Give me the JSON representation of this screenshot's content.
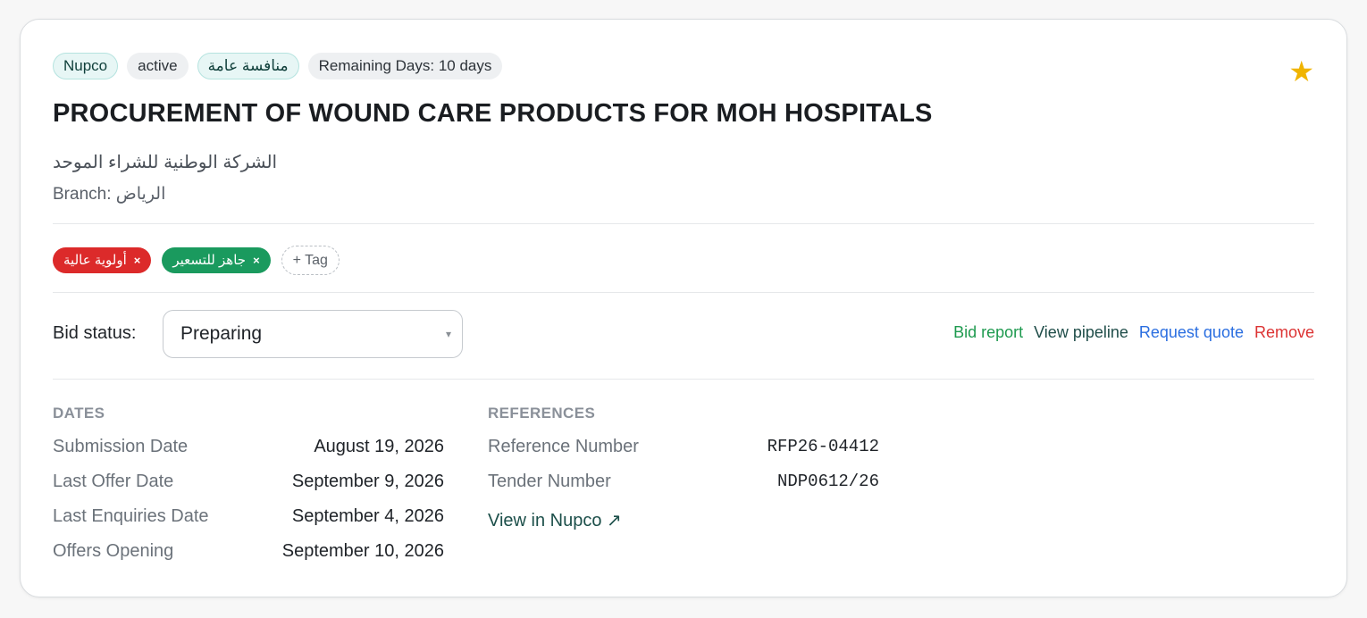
{
  "badges": {
    "source": "Nupco",
    "status": "active",
    "type": "منافسة عامة",
    "remaining": "Remaining Days: 10 days"
  },
  "favorite": {
    "icon": "star-icon",
    "color": "#f0b400",
    "active": true
  },
  "title": "PROCUREMENT OF WOUND CARE PRODUCTS FOR MOH HOSPITALS",
  "agency": "الشركة الوطنية للشراء الموحد",
  "branch": "Branch: الرياض",
  "tags": [
    {
      "label": "أولوية عالية",
      "color": "#dc2a2a",
      "remove": "×"
    },
    {
      "label": "جاهز للتسعير",
      "color": "#1a9a5e",
      "remove": "×"
    }
  ],
  "add_tag_label": "+ Tag",
  "bid_status": {
    "label": "Bid status:",
    "selected": "Preparing",
    "chevron": "▾"
  },
  "actions": {
    "bid_report": "Bid report",
    "view_pipeline": "View pipeline",
    "request_quote": "Request quote",
    "remove": "Remove"
  },
  "dates": {
    "heading": "DATES",
    "rows": [
      {
        "label": "Submission Date",
        "value": "August 19, 2026"
      },
      {
        "label": "Last Offer Date",
        "value": "September 9, 2026"
      },
      {
        "label": "Last Enquiries Date",
        "value": "September 4, 2026"
      },
      {
        "label": "Offers Opening",
        "value": "September 10, 2026"
      }
    ]
  },
  "references": {
    "heading": "REFERENCES",
    "rows": [
      {
        "label": "Reference Number",
        "value": "RFP26-04412"
      },
      {
        "label": "Tender Number",
        "value": "NDP0612/26"
      }
    ],
    "link": "View in Nupco ↗"
  }
}
